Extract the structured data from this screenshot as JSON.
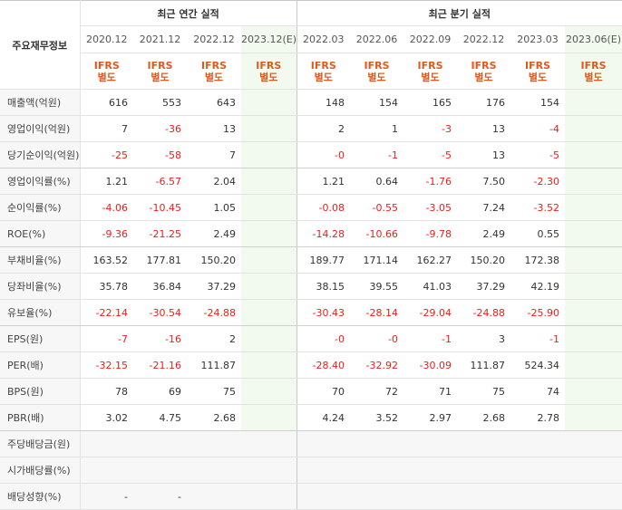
{
  "header": {
    "stub": "주요재무정보",
    "annual_title": "최근 연간 실적",
    "quarter_title": "최근 분기 실적",
    "annual_periods": [
      "2020.12",
      "2021.12",
      "2022.12",
      "2023.12(E)"
    ],
    "quarter_periods": [
      "2022.03",
      "2022.06",
      "2022.09",
      "2022.12",
      "2023.03",
      "2023.06(E)"
    ],
    "ifrs_line1": "IFRS",
    "ifrs_line2": "별도"
  },
  "rows": [
    {
      "label": "매출액(억원)",
      "annual": [
        "616",
        "553",
        "643",
        ""
      ],
      "quarter": [
        "148",
        "154",
        "165",
        "176",
        "154",
        ""
      ]
    },
    {
      "label": "영업이익(억원)",
      "annual": [
        "7",
        "-36",
        "13",
        ""
      ],
      "quarter": [
        "2",
        "1",
        "-3",
        "13",
        "-4",
        ""
      ]
    },
    {
      "label": "당기순이익(억원)",
      "annual": [
        "-25",
        "-58",
        "7",
        ""
      ],
      "quarter": [
        "-0",
        "-1",
        "-5",
        "13",
        "-5",
        ""
      ]
    },
    {
      "label": "영업이익률(%)",
      "annual": [
        "1.21",
        "-6.57",
        "2.04",
        ""
      ],
      "quarter": [
        "1.21",
        "0.64",
        "-1.76",
        "7.50",
        "-2.30",
        ""
      ]
    },
    {
      "label": "순이익률(%)",
      "annual": [
        "-4.06",
        "-10.45",
        "1.05",
        ""
      ],
      "quarter": [
        "-0.08",
        "-0.55",
        "-3.05",
        "7.24",
        "-3.52",
        ""
      ]
    },
    {
      "label": "ROE(%)",
      "annual": [
        "-9.36",
        "-21.25",
        "2.49",
        ""
      ],
      "quarter": [
        "-14.28",
        "-10.66",
        "-9.78",
        "2.49",
        "0.55",
        ""
      ]
    },
    {
      "label": "부채비율(%)",
      "annual": [
        "163.52",
        "177.81",
        "150.20",
        ""
      ],
      "quarter": [
        "189.77",
        "171.14",
        "162.27",
        "150.20",
        "172.38",
        ""
      ]
    },
    {
      "label": "당좌비율(%)",
      "annual": [
        "35.78",
        "36.84",
        "37.29",
        ""
      ],
      "quarter": [
        "38.15",
        "39.55",
        "41.03",
        "37.29",
        "42.19",
        ""
      ]
    },
    {
      "label": "유보율(%)",
      "annual": [
        "-22.14",
        "-30.54",
        "-24.88",
        ""
      ],
      "quarter": [
        "-30.43",
        "-28.14",
        "-29.04",
        "-24.88",
        "-25.90",
        ""
      ]
    },
    {
      "label": "EPS(원)",
      "annual": [
        "-7",
        "-16",
        "2",
        ""
      ],
      "quarter": [
        "-0",
        "-0",
        "-1",
        "3",
        "-1",
        ""
      ]
    },
    {
      "label": "PER(배)",
      "annual": [
        "-32.15",
        "-21.16",
        "111.87",
        ""
      ],
      "quarter": [
        "-28.40",
        "-32.92",
        "-30.09",
        "111.87",
        "524.34",
        ""
      ]
    },
    {
      "label": "BPS(원)",
      "annual": [
        "78",
        "69",
        "75",
        ""
      ],
      "quarter": [
        "70",
        "72",
        "71",
        "75",
        "74",
        ""
      ]
    },
    {
      "label": "PBR(배)",
      "annual": [
        "3.02",
        "4.75",
        "2.68",
        ""
      ],
      "quarter": [
        "4.24",
        "3.52",
        "2.97",
        "2.68",
        "2.78",
        ""
      ]
    },
    {
      "label": "주당배당금(원)",
      "annual": [
        "",
        "",
        "",
        ""
      ],
      "quarter": [
        "",
        "",
        "",
        "",
        "",
        ""
      ]
    },
    {
      "label": "시가배당률(%)",
      "annual": [
        "",
        "",
        "",
        ""
      ],
      "quarter": [
        "",
        "",
        "",
        "",
        "",
        ""
      ]
    },
    {
      "label": "배당성향(%)",
      "annual": [
        "-",
        "-",
        "",
        ""
      ],
      "quarter": [
        "",
        "",
        "",
        "",
        "",
        ""
      ]
    }
  ]
}
